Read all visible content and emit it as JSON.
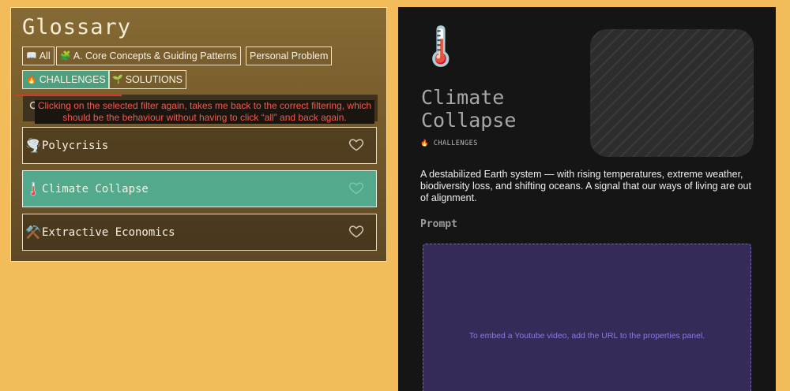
{
  "glossary": {
    "title": "Glossary",
    "filters": [
      {
        "icon": "📖",
        "label": "All"
      },
      {
        "icon": "🧩",
        "label": "A. Core Concepts & Guiding Patterns"
      },
      {
        "icon": "",
        "label": "Personal Problem"
      },
      {
        "icon": "🔥",
        "label": "CHALLENGES"
      },
      {
        "icon": "🌱",
        "label": "SOLUTIONS"
      }
    ],
    "active_filter": "CHALLENGES",
    "search": {
      "placeholder": ""
    },
    "annotation": "Clicking on the selected filter again, takes me back to the correct filtering, which should be the behaviour without having to click “all” and back again.",
    "terms": [
      {
        "icon": "🌪️",
        "label": "Polycrisis",
        "selected": false
      },
      {
        "icon": "🌡️",
        "label": "Climate Collapse",
        "selected": true
      },
      {
        "icon": "⚒️",
        "label": "Extractive Economics",
        "selected": false
      }
    ]
  },
  "detail": {
    "icon": "🌡️",
    "title": "Climate Collapse",
    "tag_icon": "🔥",
    "tag": "CHALLENGES",
    "description": "A destabilized Earth system — with rising temperatures, extreme weather, biodiversity loss, and shifting oceans. A signal that our ways of living are out of alignment.",
    "prompt_label": "Prompt",
    "embed_text": "To embed a Youtube video, add the URL to the properties panel."
  },
  "colors": {
    "background": "#f2bc5b",
    "accent_green": "#4e9f82",
    "annotation_red": "#f45a4c",
    "embed_purple": "#362a58"
  }
}
